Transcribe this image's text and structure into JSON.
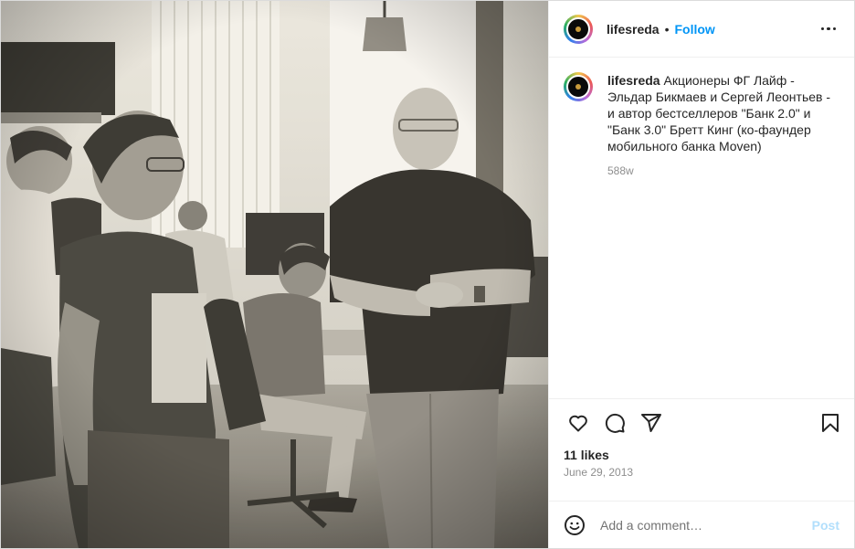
{
  "post": {
    "username": "lifesreda",
    "separator": "•",
    "follow_label": "Follow",
    "caption_text": "Акционеры ФГ Лайф - Эльдар Бикмаев и Сергей Леонтьев - и автор бестселлеров \"Банк 2.0\" и \"Банк 3.0\" Бретт Кинг (ко-фаундер мобильного банка Moven)",
    "caption_age": "588w",
    "likes": "11 likes",
    "date": "June 29, 2013",
    "comment_placeholder": "Add a comment…",
    "post_label": "Post"
  },
  "photo": {
    "description_icon": "photo-image",
    "tone": "sepia-black-and-white"
  },
  "icons": {
    "like": "heart-icon",
    "comment": "comment-icon",
    "share": "share-icon",
    "save": "bookmark-icon",
    "emoji": "emoji-icon",
    "more": "more-options-icon"
  },
  "colors": {
    "accent": "#0095f6",
    "post_disabled": "#b2dffc",
    "text": "#262626",
    "muted": "#8e8e8e"
  }
}
